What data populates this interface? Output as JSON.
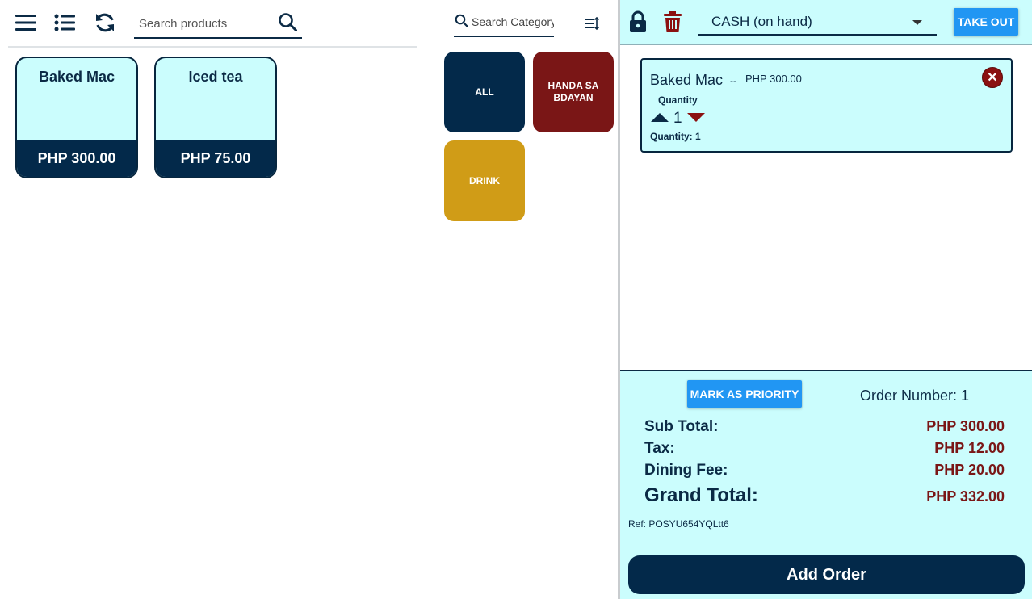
{
  "toolbar": {
    "menu_icon": "hamburger-menu-icon",
    "list_icon": "list-icon",
    "refresh_icon": "refresh-icon",
    "search_products_placeholder": "Search products",
    "search_icon": "search-icon"
  },
  "products": [
    {
      "name": "Baked Mac",
      "price": "PHP 300.00"
    },
    {
      "name": "Iced tea",
      "price": "PHP 75.00"
    }
  ],
  "categories": {
    "search_placeholder": "Search Category",
    "sort_icon": "sort-icon",
    "items": [
      {
        "label": "ALL",
        "color": "#03294a"
      },
      {
        "label": "HANDA SA BDAYAN",
        "color": "#7a1616"
      },
      {
        "label": "DRINK",
        "color": "#d09c17"
      }
    ]
  },
  "order_panel": {
    "lock_icon": "lock-icon",
    "trash_icon": "trash-icon",
    "payment_method": "CASH (on hand)",
    "take_out_label": "TAKE OUT",
    "items": [
      {
        "name": "Baked Mac",
        "separator": "--",
        "price": "PHP 300.00",
        "quantity_label": "Quantity",
        "quantity": "1",
        "quantity_summary": "Quantity: 1"
      }
    ],
    "priority_label": "MARK AS PRIORITY",
    "order_number": "Order Number: 1",
    "totals": {
      "subtotal_label": "Sub Total:",
      "subtotal": "PHP 300.00",
      "tax_label": "Tax:",
      "tax": "PHP 12.00",
      "dining_fee_label": "Dining Fee:",
      "dining_fee": "PHP 20.00",
      "grand_total_label": "Grand Total:",
      "grand_total": "PHP 332.00"
    },
    "reference": "Ref: POSYU654YQLtt6",
    "add_order_label": "Add Order"
  },
  "colors": {
    "navy": "#03294a",
    "light_cyan": "#cbfdfd",
    "button_blue": "#2196f3",
    "dark_red": "#7a1616",
    "mustard": "#d09c17"
  }
}
